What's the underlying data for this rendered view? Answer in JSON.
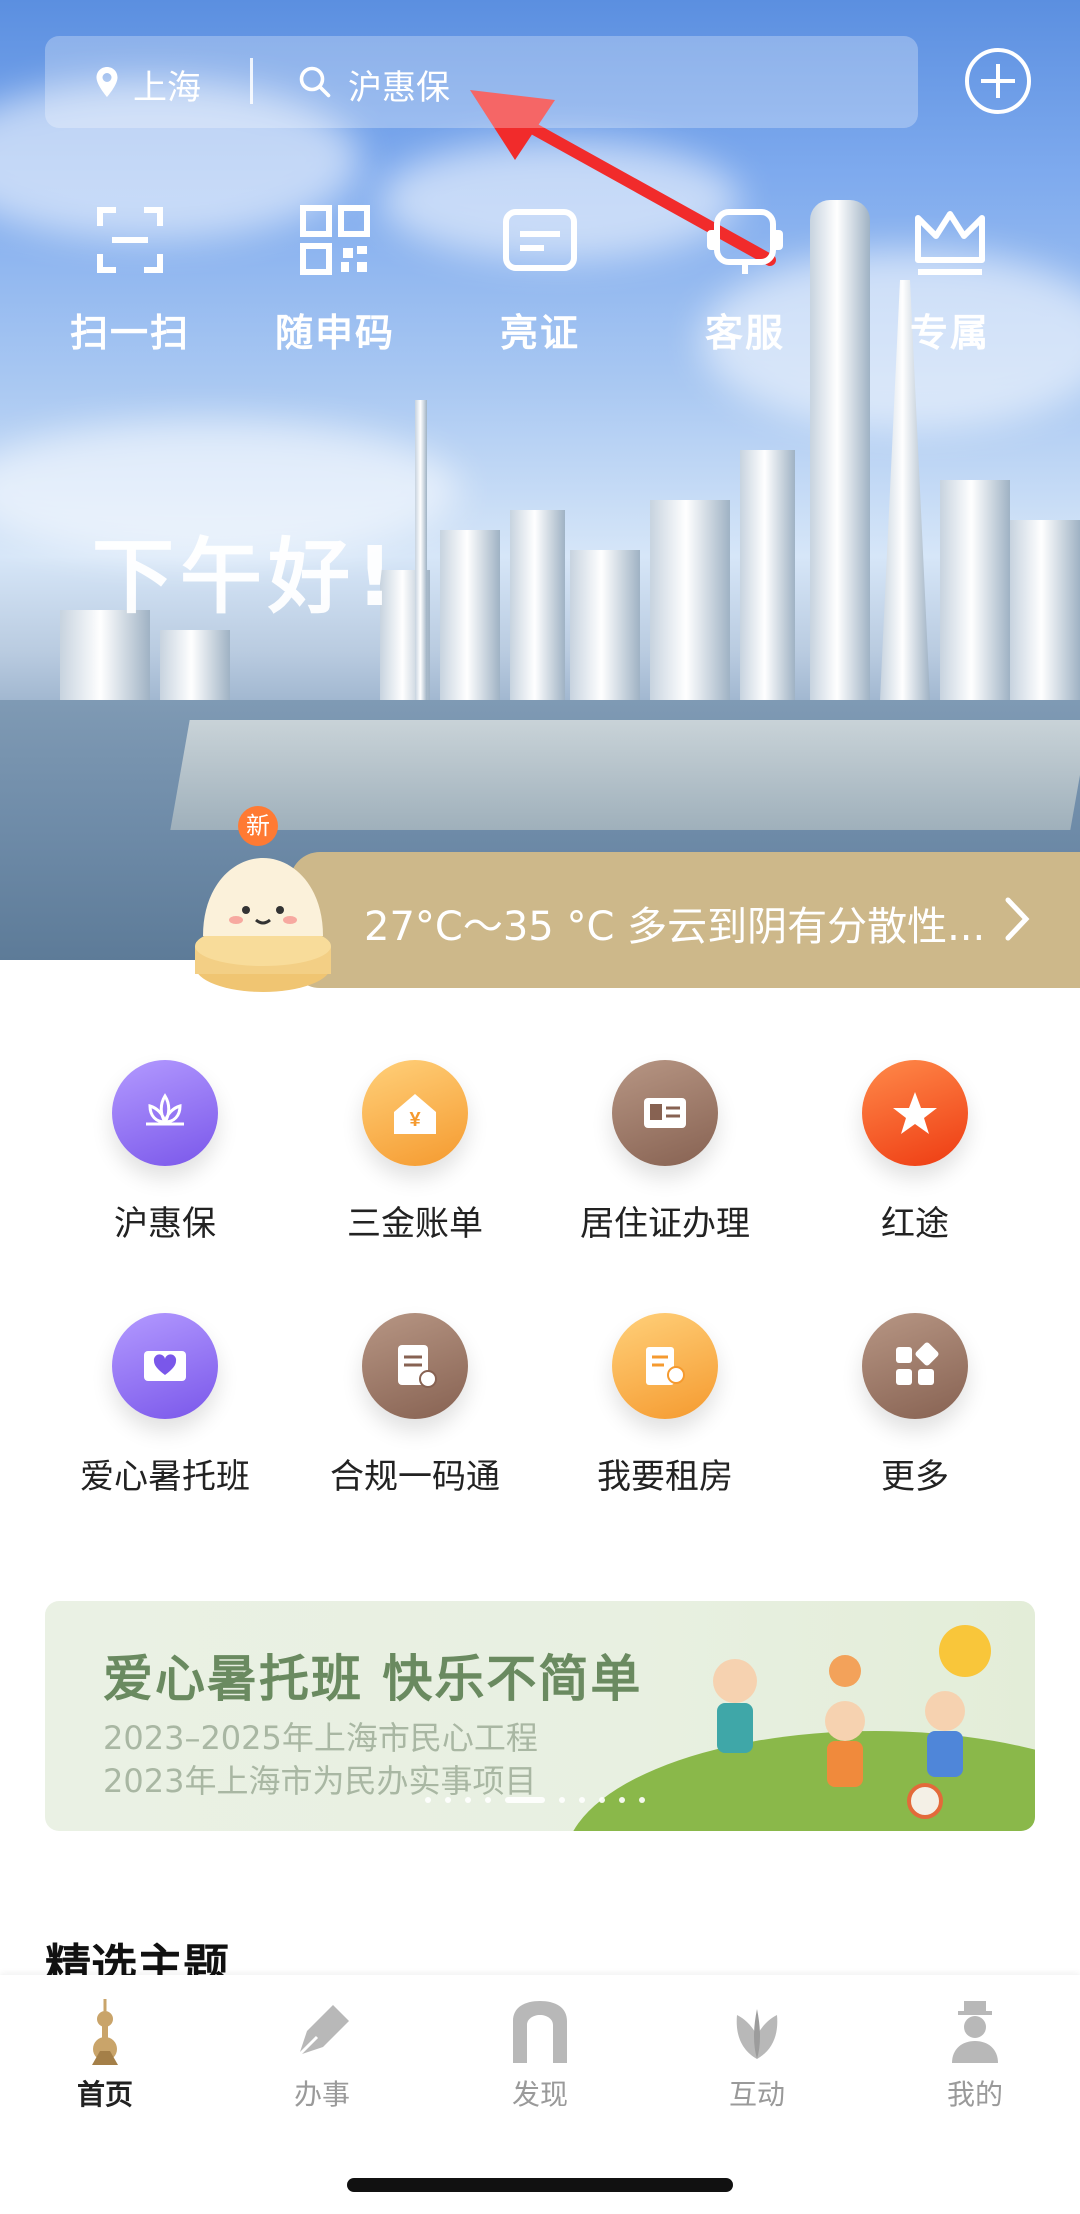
{
  "header": {
    "location": "上海",
    "search_placeholder": "沪惠保"
  },
  "quick_actions": [
    {
      "label": "扫一扫",
      "icon": "scan-icon"
    },
    {
      "label": "随申码",
      "icon": "qr-code-icon"
    },
    {
      "label": "亮证",
      "icon": "card-icon"
    },
    {
      "label": "客服",
      "icon": "customer-service-icon"
    },
    {
      "label": "专属",
      "icon": "crown-icon"
    }
  ],
  "greeting": "下午好!",
  "weather": {
    "text": "27°C～35 °C 多云到阴有分散性...",
    "badge": "新"
  },
  "services": [
    {
      "label": "沪惠保",
      "icon": "lotus-icon",
      "color": "#8b6cf0"
    },
    {
      "label": "三金账单",
      "icon": "yuan-house-icon",
      "color": "#f8a63a"
    },
    {
      "label": "居住证办理",
      "icon": "residence-card-icon",
      "color": "#9b7562"
    },
    {
      "label": "红途",
      "icon": "red-route-icon",
      "color": "#f24b1c"
    },
    {
      "label": "爱心暑托班",
      "icon": "heart-book-icon",
      "color": "#8b6cf0"
    },
    {
      "label": "合规一码通",
      "icon": "document-icon",
      "color": "#9b7562"
    },
    {
      "label": "我要租房",
      "icon": "rent-house-icon",
      "color": "#f8a63a"
    },
    {
      "label": "更多",
      "icon": "more-grid-icon",
      "color": "#9b7562"
    }
  ],
  "banner": {
    "title": "爱心暑托班  快乐不简单",
    "line1": "2023–2025年上海市民心工程",
    "line2": "2023年上海市为民办实事项目",
    "active_slide": 5,
    "slide_count": 10
  },
  "section_title": "精选主题",
  "tabs": [
    {
      "label": "首页",
      "icon": "tower-icon"
    },
    {
      "label": "办事",
      "icon": "pen-icon"
    },
    {
      "label": "发现",
      "icon": "arch-icon"
    },
    {
      "label": "互动",
      "icon": "magnolia-icon"
    },
    {
      "label": "我的",
      "icon": "person-icon"
    }
  ]
}
